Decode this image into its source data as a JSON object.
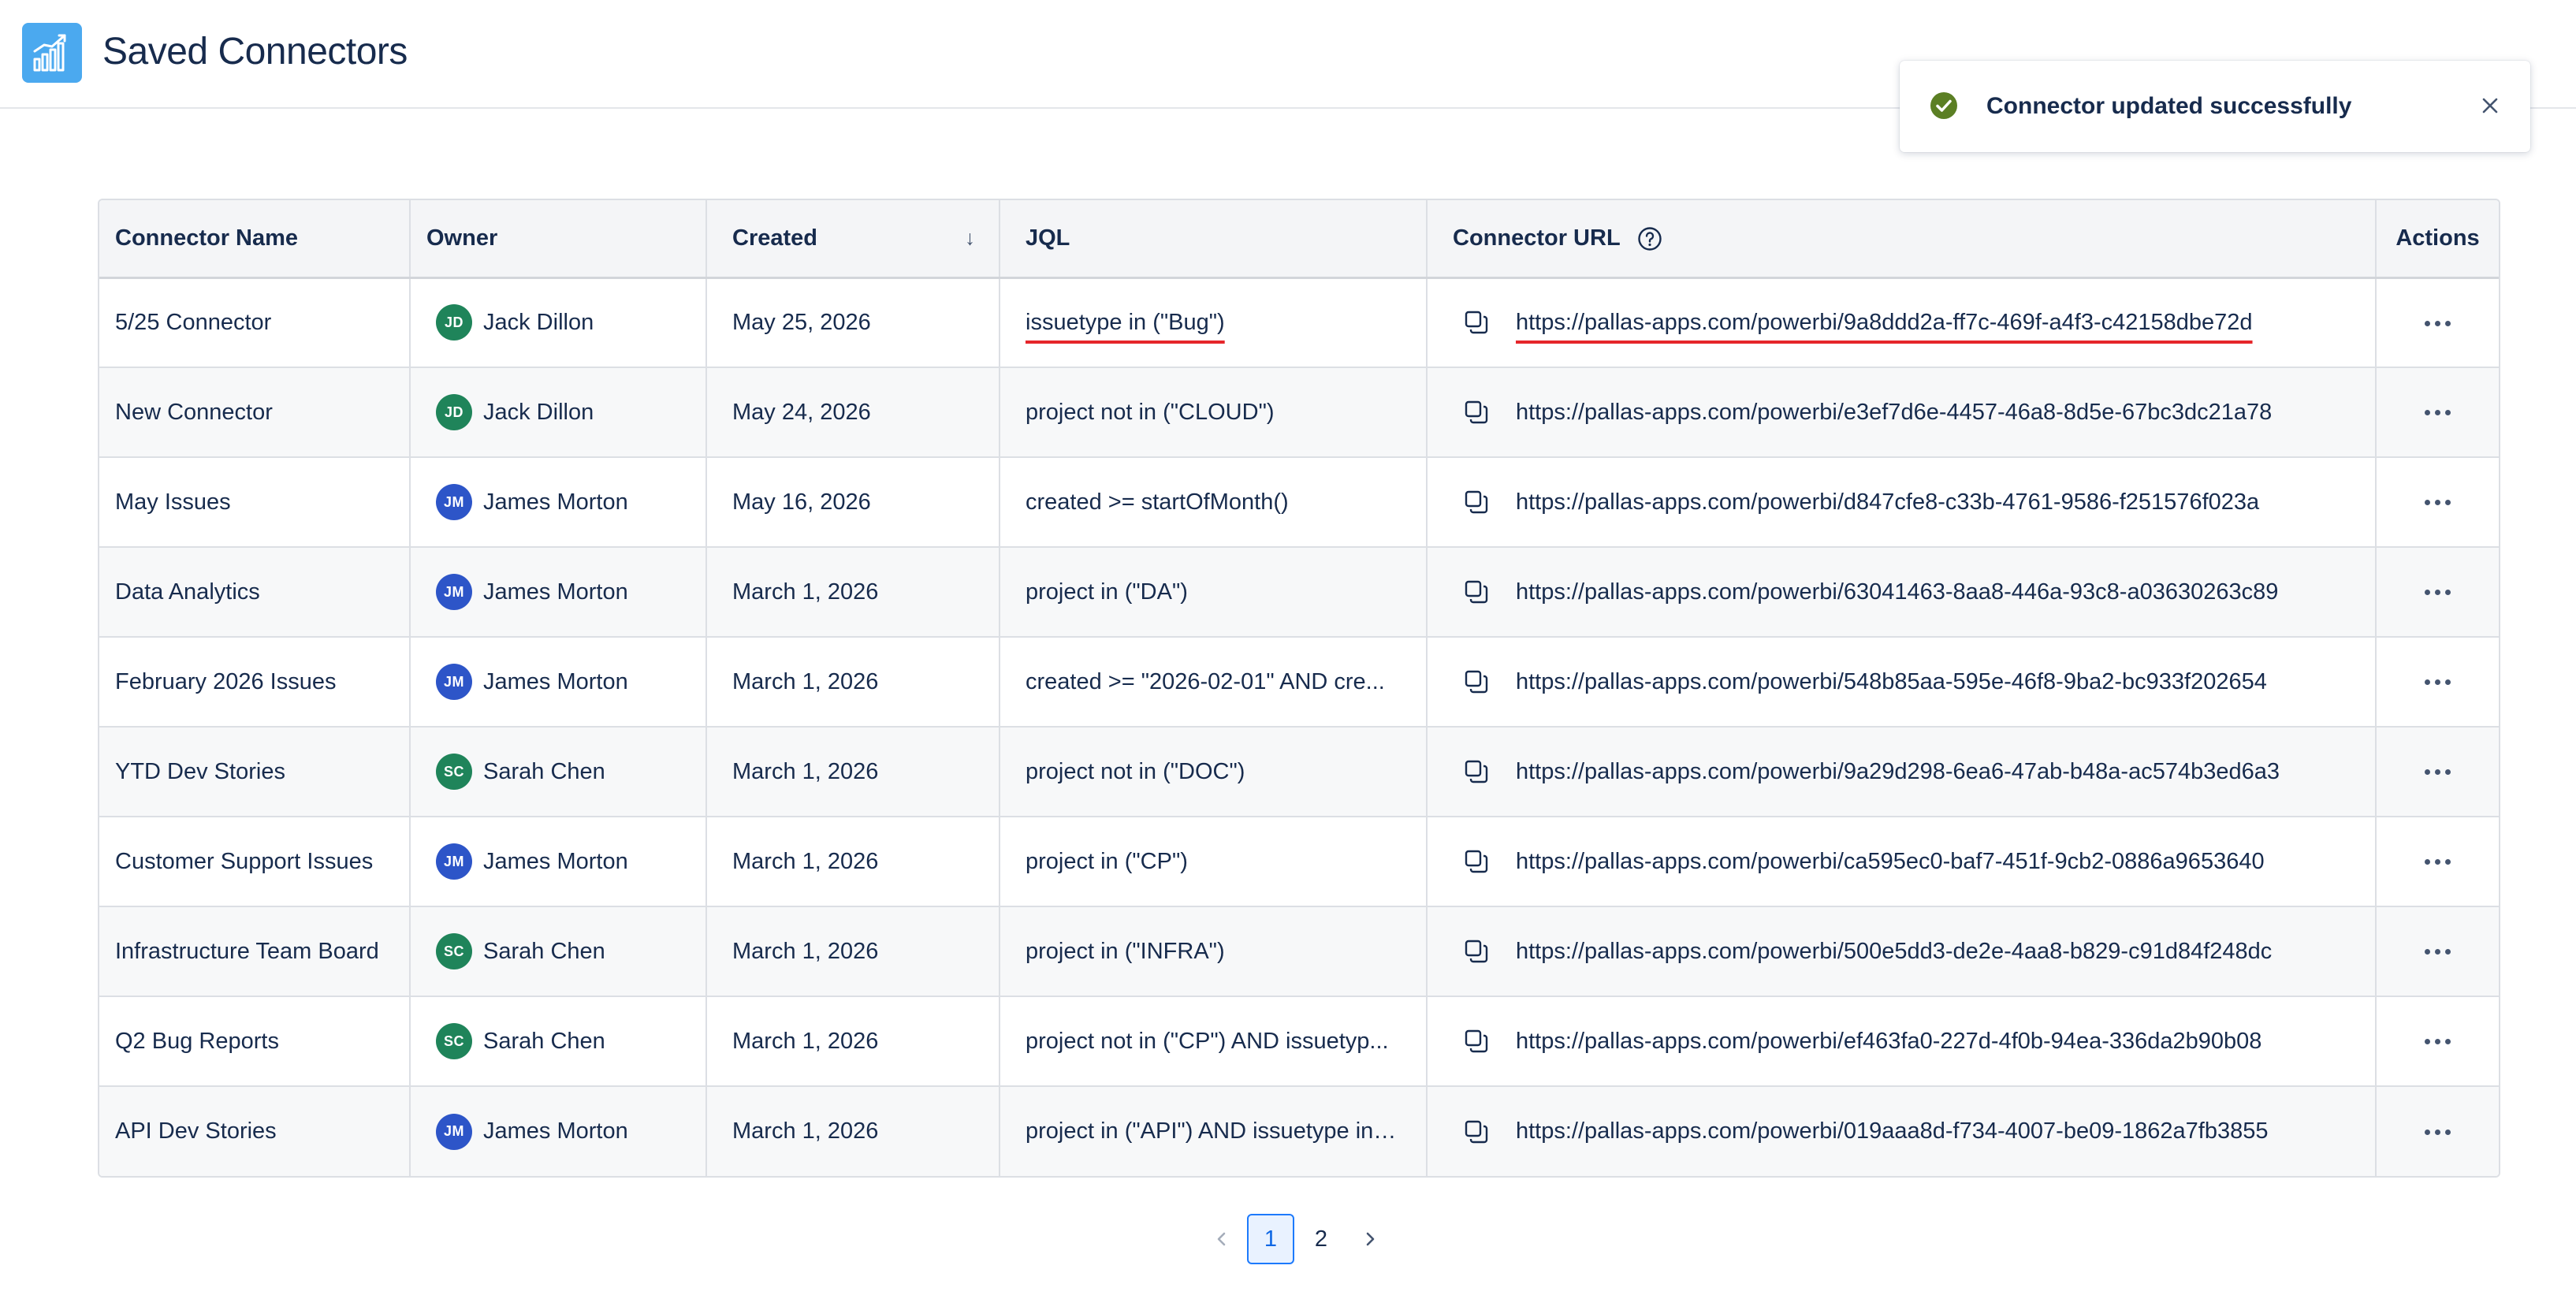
{
  "header": {
    "title": "Saved Connectors",
    "logo_icon": "bar-chart-icon",
    "logo_color": "#4ba9ef"
  },
  "toast": {
    "message": "Connector updated successfully",
    "status_icon": "check-circle-icon",
    "status_color": "#5b7f24",
    "close_icon": "close-icon"
  },
  "table": {
    "columns": {
      "name": "Connector Name",
      "owner": "Owner",
      "created": "Created",
      "jql": "JQL",
      "url": "Connector URL",
      "actions": "Actions"
    },
    "sort": {
      "column": "created",
      "direction": "descending"
    },
    "rows": [
      {
        "name": "5/25 Connector",
        "owner": "Jack Dillon",
        "initials": "JD",
        "avatar_color": "#1f845a",
        "created": "May 25, 2026",
        "jql": "issuetype in (\"Bug\")",
        "url": "https://pallas-apps.com/powerbi/9a8ddd2a-ff7c-469f-a4f3-c42158dbe72d",
        "highlighted": true
      },
      {
        "name": "New Connector",
        "owner": "Jack Dillon",
        "initials": "JD",
        "avatar_color": "#1f845a",
        "created": "May 24, 2026",
        "jql": "project not in (\"CLOUD\")",
        "url": "https://pallas-apps.com/powerbi/e3ef7d6e-4457-46a8-8d5e-67bc3dc21a78"
      },
      {
        "name": "May Issues",
        "owner": "James Morton",
        "initials": "JM",
        "avatar_color": "#2d55c8",
        "created": "May 16, 2026",
        "jql": "created >= startOfMonth()",
        "url": "https://pallas-apps.com/powerbi/d847cfe8-c33b-4761-9586-f251576f023a"
      },
      {
        "name": "Data Analytics",
        "owner": "James Morton",
        "initials": "JM",
        "avatar_color": "#2d55c8",
        "created": "March 1, 2026",
        "jql": "project in (\"DA\")",
        "url": "https://pallas-apps.com/powerbi/63041463-8aa8-446a-93c8-a03630263c89"
      },
      {
        "name": "February 2026 Issues",
        "owner": "James Morton",
        "initials": "JM",
        "avatar_color": "#2d55c8",
        "created": "March 1, 2026",
        "jql": "created >= \"2026-02-01\" AND cre...",
        "url": "https://pallas-apps.com/powerbi/548b85aa-595e-46f8-9ba2-bc933f202654"
      },
      {
        "name": "YTD Dev Stories",
        "owner": "Sarah Chen",
        "initials": "SC",
        "avatar_color": "#1f845a",
        "created": "March 1, 2026",
        "jql": "project not in (\"DOC\")",
        "url": "https://pallas-apps.com/powerbi/9a29d298-6ea6-47ab-b48a-ac574b3ed6a3"
      },
      {
        "name": "Customer Support Issues",
        "owner": "James Morton",
        "initials": "JM",
        "avatar_color": "#2d55c8",
        "created": "March 1, 2026",
        "jql": "project in (\"CP\")",
        "url": "https://pallas-apps.com/powerbi/ca595ec0-baf7-451f-9cb2-0886a9653640"
      },
      {
        "name": "Infrastructure Team Board",
        "owner": "Sarah Chen",
        "initials": "SC",
        "avatar_color": "#1f845a",
        "created": "March 1, 2026",
        "jql": "project in (\"INFRA\")",
        "url": "https://pallas-apps.com/powerbi/500e5dd3-de2e-4aa8-b829-c91d84f248dc"
      },
      {
        "name": "Q2 Bug Reports",
        "owner": "Sarah Chen",
        "initials": "SC",
        "avatar_color": "#1f845a",
        "created": "March 1, 2026",
        "jql": "project not in (\"CP\") AND issuetyp...",
        "url": "https://pallas-apps.com/powerbi/ef463fa0-227d-4f0b-94ea-336da2b90b08"
      },
      {
        "name": "API Dev Stories",
        "owner": "James Morton",
        "initials": "JM",
        "avatar_color": "#2d55c8",
        "created": "March 1, 2026",
        "jql": "project in (\"API\") AND issuetype in ...",
        "url": "https://pallas-apps.com/powerbi/019aaa8d-f734-4007-be09-1862a7fb3855"
      }
    ]
  },
  "pagination": {
    "pages": [
      "1",
      "2"
    ],
    "current": "1",
    "accent_color": "#1d7afc"
  }
}
